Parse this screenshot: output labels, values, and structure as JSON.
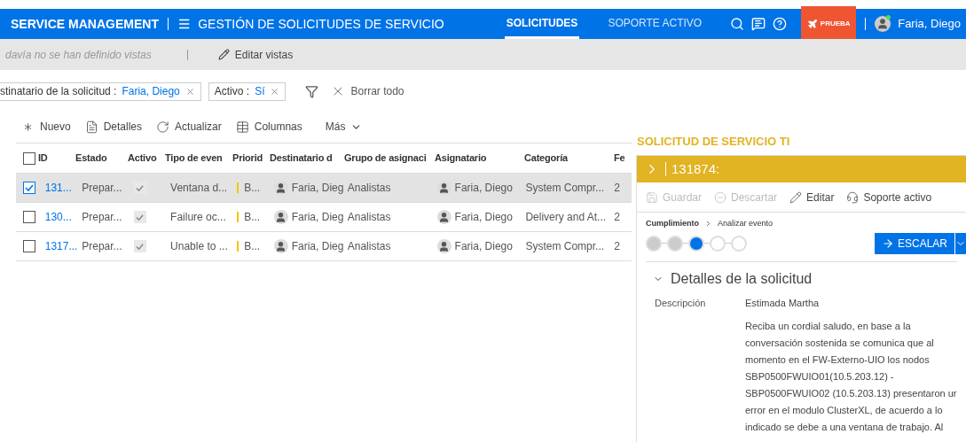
{
  "header": {
    "brand": "SERVICE MANAGEMENT",
    "title": "GESTIÓN DE SOLICITUDES DE SERVICIO",
    "tabs": [
      {
        "label": "SOLICITUDES",
        "selected": true
      },
      {
        "label": "SOPORTE ACTIVO",
        "selected": false
      }
    ],
    "trial": "PRUEBA",
    "user": "Faria, Diego"
  },
  "views_bar": {
    "empty_text": "davía no se han definido vistas",
    "edit": "Editar vistas"
  },
  "filters": {
    "chips": [
      {
        "label": "stinatario de la solicitud :",
        "value": "Faria, Diego"
      },
      {
        "label": "Activo :",
        "value": "Sí"
      }
    ],
    "clear": "Borrar todo"
  },
  "toolbar": [
    "Nuevo",
    "Detalles",
    "Actualizar",
    "Columnas",
    "Más"
  ],
  "table": {
    "select_all": {
      "checked": false
    },
    "columns": [
      "ID",
      "Estado",
      "Activo",
      "Tipo de even",
      "Priorid",
      "Destinatario d",
      "Grupo de asignaci",
      "Asignatario",
      "Categoría",
      "Fe"
    ],
    "rows": [
      {
        "selected": true,
        "id": "131...",
        "estado": "Prepar...",
        "activo": true,
        "tipo": "Ventana d...",
        "prioridad": "B...",
        "destinatario": "Faria, Dieg",
        "grupo": "Analistas",
        "asignatario": "Faria, Diego",
        "categoria": "System Compr...",
        "fecha": "2"
      },
      {
        "selected": false,
        "id": "130...",
        "estado": "Prepar...",
        "activo": true,
        "tipo": "Failure oc...",
        "prioridad": "B...",
        "destinatario": "Faria, Dieg",
        "grupo": "Analistas",
        "asignatario": "Faria, Diego",
        "categoria": "Delivery and At...",
        "fecha": "2"
      },
      {
        "selected": false,
        "id": "1317...",
        "estado": "Prepar...",
        "activo": true,
        "tipo": "Unable to ...",
        "prioridad": "B...",
        "destinatario": "Faria, Dieg",
        "grupo": "Analistas",
        "asignatario": "Faria, Diego",
        "categoria": "System Compr...",
        "fecha": "2"
      }
    ]
  },
  "detail": {
    "heading": "SOLICITUD DE SERVICIO TI",
    "record": "131874:",
    "actions": [
      {
        "label": "Guardar",
        "disabled": true
      },
      {
        "label": "Descartar",
        "disabled": true
      },
      {
        "label": "Editar",
        "disabled": false
      },
      {
        "label": "Soporte activo",
        "disabled": false
      }
    ],
    "breadcrumb": [
      "Cumplimiento",
      "Analizar evento"
    ],
    "steps": [
      {
        "kind": "done"
      },
      {
        "kind": "done"
      },
      {
        "kind": "current"
      },
      {
        "kind": "pending"
      },
      {
        "kind": "pending"
      }
    ],
    "escalate": "ESCALAR",
    "section": {
      "title": "Detalles de la solicitud",
      "expanded": true,
      "field_label": "Descripción",
      "greeting": "Estimada Martha",
      "lines": [
        "Reciba un cordial saludo, en base a la",
        "conversación sostenida se comunica que al",
        "momento en el FW-Externo-UIO los nodos",
        "SBP0500FWUIO01(10.5.203.12)  -",
        "SBP0500FWUIO02 (10.5.203.13) presentaron ur",
        "error en el modulo ClusterXL, de acuerdo a lo",
        "indicado se debe a una ventana de trabajo. Al"
      ]
    }
  }
}
